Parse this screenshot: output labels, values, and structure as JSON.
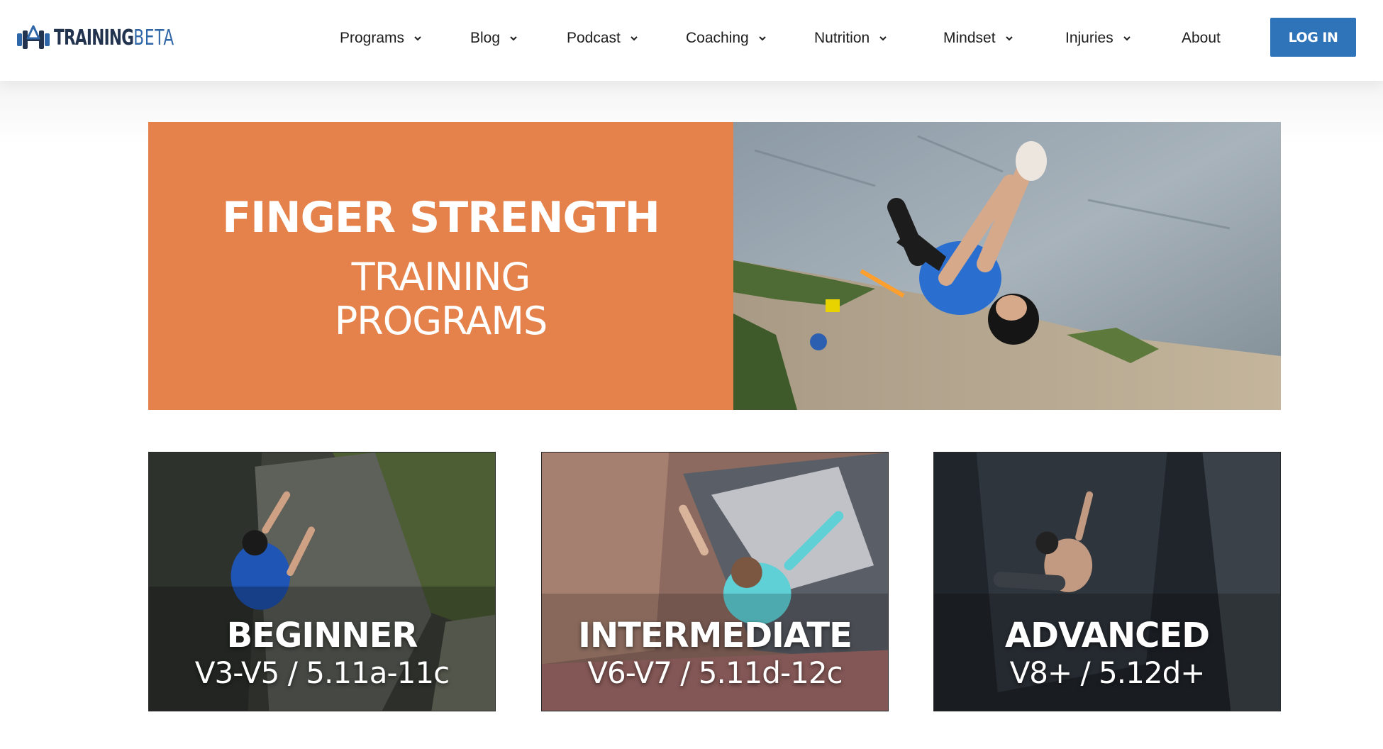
{
  "brand": {
    "name_strong": "TRAINING",
    "name_light": "BETA",
    "accent_color": "#2f74b9",
    "logo_icon": "barbell-mountain-icon"
  },
  "nav": {
    "items": [
      {
        "label": "Programs",
        "has_dropdown": true
      },
      {
        "label": "Blog",
        "has_dropdown": true
      },
      {
        "label": "Podcast",
        "has_dropdown": true
      },
      {
        "label": "Coaching",
        "has_dropdown": true
      },
      {
        "label": "Nutrition",
        "has_dropdown": true
      },
      {
        "label": "Mindset",
        "has_dropdown": true
      },
      {
        "label": "Injuries",
        "has_dropdown": true
      },
      {
        "label": "About",
        "has_dropdown": false
      }
    ],
    "login_label": "LOG IN",
    "dropdown_icon": "chevron-down-icon"
  },
  "hero": {
    "title": "FINGER STRENGTH",
    "subtitle_line1": "TRAINING",
    "subtitle_line2": "PROGRAMS",
    "panel_color": "#e5814a"
  },
  "programs": [
    {
      "level": "BEGINNER",
      "grades": "V3-V5 / 5.11a-11c"
    },
    {
      "level": "INTERMEDIATE",
      "grades": "V6-V7 / 5.11d-12c"
    },
    {
      "level": "ADVANCED",
      "grades": "V8+ / 5.12d+"
    }
  ]
}
